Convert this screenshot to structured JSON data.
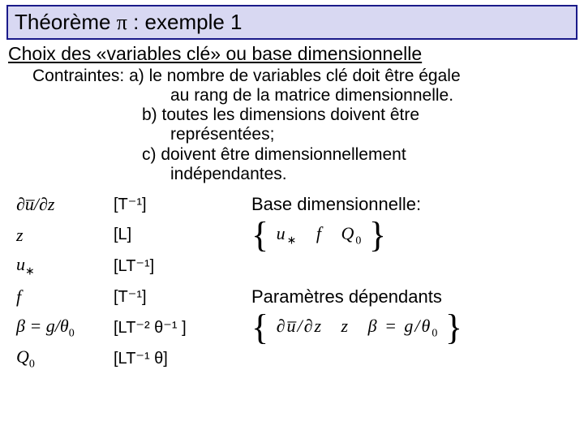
{
  "title": {
    "t1": "Théorème ",
    "pi": "π",
    "t2": " : exemple 1"
  },
  "subtitle": "Choix des «variables clé» ou base dimensionnelle",
  "constraints": {
    "lead": "Contraintes: ",
    "a1": "a) le nombre de variables clé  doit être égale",
    "a2": "au rang de la matrice dimensionnelle.",
    "b1": "b) toutes les dimensions doivent être",
    "b2": "représentées;",
    "c1": "c) doivent être dimensionnellement",
    "c2": "indépendantes."
  },
  "dims": {
    "r1": "[T⁻¹]",
    "r2": "[L]",
    "r3": "[LT⁻¹]",
    "r4": "[T⁻¹]",
    "r5": "[LT⁻² θ⁻¹ ]",
    "r6": "[LT⁻¹ θ]"
  },
  "rhs": {
    "base_label": "Base dimensionnelle:",
    "dep_label": "Paramètres dépendants"
  },
  "sym": {
    "dudz": "∂u̅/∂z",
    "z": "z",
    "ustar_u": "u",
    "ustar_s": "∗",
    "f": "f",
    "beta": "β = g/θ",
    "beta_s": "0",
    "Q": "Q",
    "Q_s": "0"
  },
  "sets": {
    "base": {
      "open": "{",
      "u": "u",
      "us": "∗",
      "f": "f",
      "Q": "Q",
      "Qs": "0",
      "close": "}"
    },
    "dep": {
      "open": "{",
      "dudz": "∂u̅/∂z",
      "z": "z",
      "beta": "β = g/θ",
      "bs": "0",
      "close": "}"
    }
  }
}
